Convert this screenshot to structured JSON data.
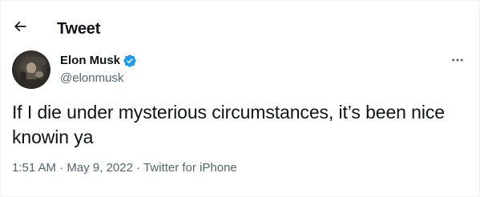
{
  "header": {
    "back_icon": "arrow-left-icon",
    "title": "Tweet"
  },
  "author": {
    "display_name": "Elon Musk",
    "handle": "@elonmusk",
    "verified_icon": "verified-badge-icon",
    "verified_color": "#1d9bf0"
  },
  "tweet": {
    "text": "If I die under mysterious circumstances, it’s been nice knowin ya",
    "time": "1:51 AM",
    "separator": "·",
    "date": "May 9, 2022",
    "source": "Twitter for iPhone"
  },
  "actions": {
    "more_icon": "more-options-icon"
  },
  "colors": {
    "text_primary": "#0f1419",
    "text_secondary": "#536471",
    "border": "#eff3f4",
    "accent": "#1d9bf0"
  }
}
